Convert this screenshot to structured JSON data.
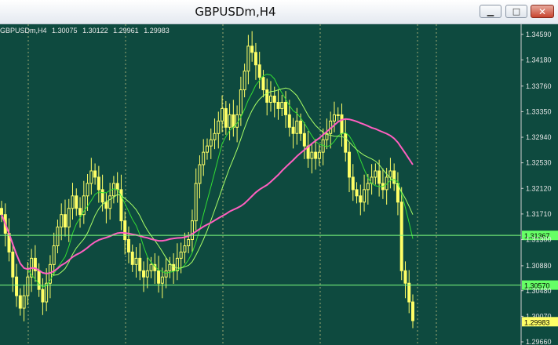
{
  "window": {
    "title": "GBPUSDm,H4",
    "minimize_icon": "minimize-icon",
    "maximize_icon": "maximize-icon",
    "close_icon": "close-icon"
  },
  "colors": {
    "background": "#0e4a3f",
    "candle": "#ffff66",
    "ma_fast": "#33dd33",
    "ma_slow": "#aaff66",
    "ma_long": "#ff5fc0",
    "hline": "#7fff7f",
    "price_tag_current": "#ffff66",
    "price_tag_line": "#66ff66"
  },
  "info_bar": {
    "symbol": "GBPUSDm,H4",
    "open": "1.30075",
    "high": "1.30122",
    "low": "1.29961",
    "close": "1.29983"
  },
  "chart_data": {
    "type": "candlestick",
    "y_ticks": [
      "1.34590",
      "1.34180",
      "1.33760",
      "1.33350",
      "1.32940",
      "1.32530",
      "1.32120",
      "1.31710",
      "1.31300",
      "1.30880",
      "1.30480",
      "1.30070",
      "1.29660"
    ],
    "ylim": [
      1.2966,
      1.347
    ],
    "horizontal_lines": [
      {
        "value": 1.31367,
        "label": "1.31367"
      },
      {
        "value": 1.3057,
        "label": "1.30570"
      }
    ],
    "current_price": {
      "value": 1.29983,
      "label": "1.29983"
    },
    "close_series": [
      1.317,
      1.314,
      1.311,
      1.307,
      1.304,
      1.302,
      1.304,
      1.307,
      1.31,
      1.308,
      1.305,
      1.303,
      1.306,
      1.309,
      1.312,
      1.315,
      1.317,
      1.315,
      1.318,
      1.32,
      1.318,
      1.317,
      1.32,
      1.322,
      1.324,
      1.323,
      1.321,
      1.319,
      1.318,
      1.32,
      1.322,
      1.321,
      1.316,
      1.313,
      1.311,
      1.309,
      1.31,
      1.308,
      1.307,
      1.308,
      1.309,
      1.308,
      1.306,
      1.307,
      1.308,
      1.309,
      1.308,
      1.31,
      1.311,
      1.312,
      1.313,
      1.316,
      1.322,
      1.325,
      1.327,
      1.328,
      1.329,
      1.33,
      1.332,
      1.334,
      1.331,
      1.333,
      1.331,
      1.333,
      1.337,
      1.34,
      1.344,
      1.343,
      1.341,
      1.339,
      1.337,
      1.335,
      1.336,
      1.335,
      1.334,
      1.335,
      1.333,
      1.331,
      1.33,
      1.332,
      1.33,
      1.328,
      1.326,
      1.327,
      1.326,
      1.327,
      1.329,
      1.33,
      1.332,
      1.333,
      1.333,
      1.33,
      1.327,
      1.323,
      1.321,
      1.32,
      1.319,
      1.321,
      1.322,
      1.323,
      1.324,
      1.322,
      1.321,
      1.323,
      1.324,
      1.322,
      1.319,
      1.308,
      1.306,
      1.303,
      1.3
    ]
  }
}
